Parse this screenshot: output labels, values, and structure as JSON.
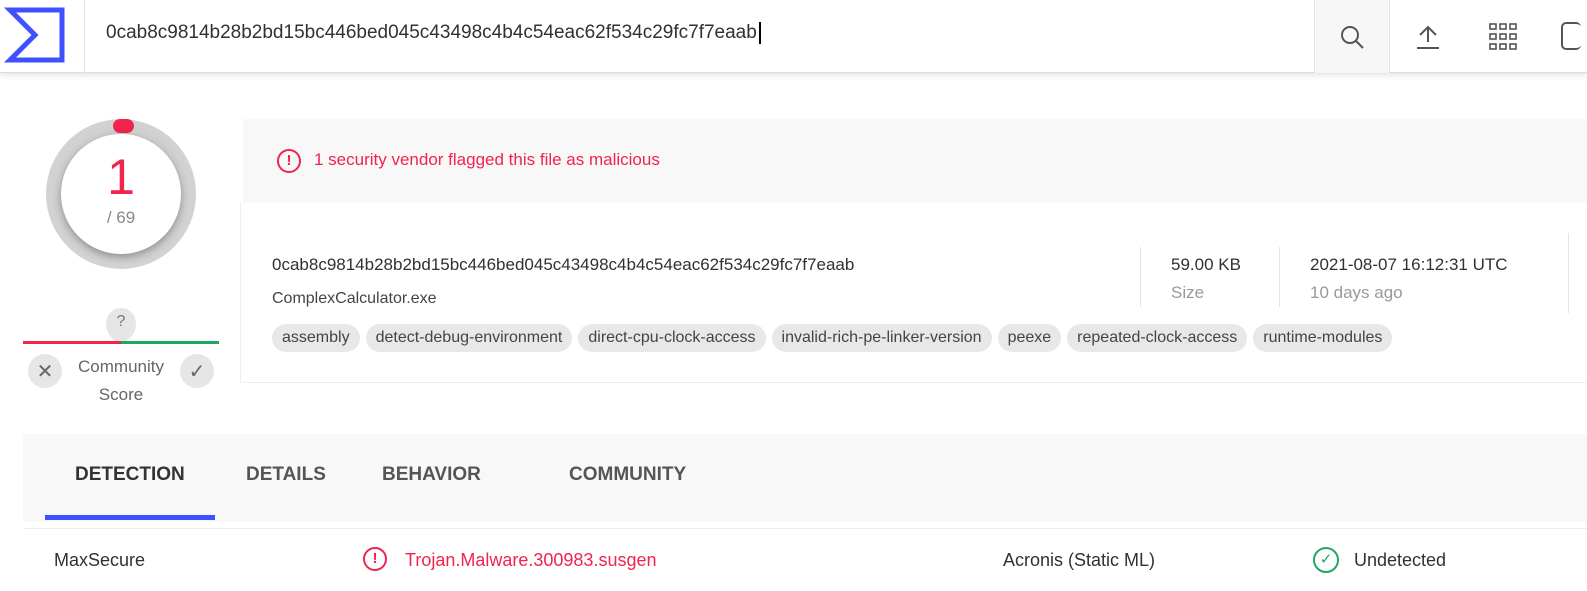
{
  "header": {
    "search_value": "0cab8c9814b28b2bd15bc446bed045c43498c4b4c54eac62f534c29fc7f7eaab"
  },
  "score": {
    "detections": "1",
    "total": "/ 69",
    "community_label": "Community Score",
    "community_unknown": "?"
  },
  "alert": "1 security vendor flagged this file as malicious",
  "file": {
    "hash": "0cab8c9814b28b2bd15bc446bed045c43498c4b4c54eac62f534c29fc7f7eaab",
    "name": "ComplexCalculator.exe",
    "size": "59.00 KB",
    "size_label": "Size",
    "date": "2021-08-07 16:12:31 UTC",
    "date_relative": "10 days ago",
    "tags": [
      "assembly",
      "detect-debug-environment",
      "direct-cpu-clock-access",
      "invalid-rich-pe-linker-version",
      "peexe",
      "repeated-clock-access",
      "runtime-modules"
    ]
  },
  "tabs": [
    "DETECTION",
    "DETAILS",
    "BEHAVIOR",
    "COMMUNITY"
  ],
  "detections": [
    {
      "vendor": "MaxSecure",
      "result": "Trojan.Malware.300983.susgen",
      "status": "malicious"
    },
    {
      "vendor": "Acronis (Static ML)",
      "result": "Undetected",
      "status": "clean"
    }
  ],
  "colors": {
    "accent": "#3f51ff",
    "malicious": "#f0244c",
    "clean": "#20a861"
  }
}
